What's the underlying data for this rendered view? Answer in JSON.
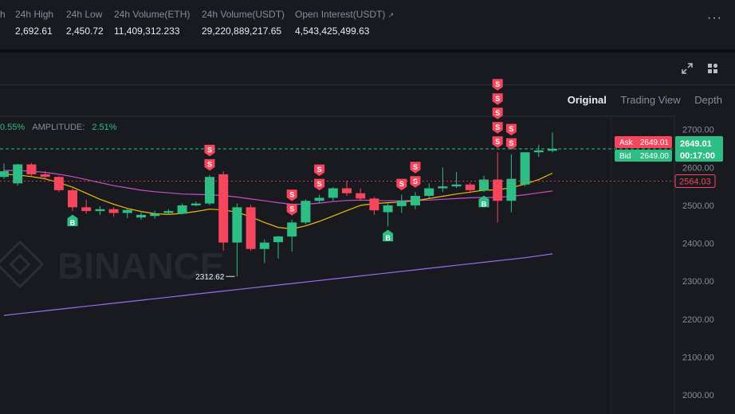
{
  "stats": {
    "cut_label": "h",
    "items": [
      {
        "label": "24h High",
        "value": "2,692.61"
      },
      {
        "label": "24h Low",
        "value": "2,450.72"
      },
      {
        "label": "24h Volume(ETH)",
        "value": "11,409,312.233"
      },
      {
        "label": "24h Volume(USDT)",
        "value": "29,220,889,217.65"
      },
      {
        "label": "Open Interest(USDT)",
        "value": "4,543,425,499.63"
      }
    ],
    "more_label": "···"
  },
  "tabs": {
    "original": "Original",
    "trading_view": "Trading View",
    "depth": "Depth"
  },
  "legend": {
    "change": "0.55%",
    "amplitude_label": "AMPLITUDE:",
    "amplitude_value": "2.51%"
  },
  "price_scale": {
    "labels": [
      "2700.00",
      "2600.00",
      "2500.00",
      "2400.00",
      "2300.00",
      "2200.00",
      "2100.00",
      "2000.00"
    ],
    "ask_label": "Ask",
    "ask_value": "2649.01",
    "bid_label": "Bid",
    "bid_value": "2649.00",
    "last_price": "2649.01",
    "countdown": "00:17:00",
    "mark_price": "2564.03"
  },
  "markers": {
    "sell": "S",
    "buy": "B"
  },
  "annotations": {
    "low_price": "2312.62"
  },
  "watermark": "BINANCE",
  "colors": {
    "up": "#2ebd85",
    "down": "#f6465d",
    "ma_fast": "#f0b90b",
    "ma_mid": "#c94fc7",
    "ma_slow": "#9a6cf5",
    "background": "#181a20"
  },
  "chart_data": {
    "type": "candlestick",
    "ylim": [
      1950,
      2735
    ],
    "candles": [
      {
        "o": 2575,
        "h": 2610,
        "l": 2570,
        "c": 2590
      },
      {
        "o": 2558,
        "h": 2610,
        "l": 2552,
        "c": 2608
      },
      {
        "o": 2608,
        "h": 2612,
        "l": 2578,
        "c": 2582
      },
      {
        "o": 2582,
        "h": 2590,
        "l": 2570,
        "c": 2575
      },
      {
        "o": 2575,
        "h": 2578,
        "l": 2535,
        "c": 2540
      },
      {
        "o": 2540,
        "h": 2545,
        "l": 2485,
        "c": 2495
      },
      {
        "o": 2495,
        "h": 2515,
        "l": 2478,
        "c": 2485
      },
      {
        "o": 2485,
        "h": 2498,
        "l": 2475,
        "c": 2490
      },
      {
        "o": 2490,
        "h": 2495,
        "l": 2470,
        "c": 2480
      },
      {
        "o": 2480,
        "h": 2492,
        "l": 2466,
        "c": 2488
      },
      {
        "o": 2468,
        "h": 2485,
        "l": 2462,
        "c": 2475
      },
      {
        "o": 2472,
        "h": 2486,
        "l": 2465,
        "c": 2478
      },
      {
        "o": 2480,
        "h": 2490,
        "l": 2475,
        "c": 2485
      },
      {
        "o": 2478,
        "h": 2505,
        "l": 2476,
        "c": 2500
      },
      {
        "o": 2500,
        "h": 2510,
        "l": 2498,
        "c": 2505
      },
      {
        "o": 2505,
        "h": 2580,
        "l": 2500,
        "c": 2575
      },
      {
        "o": 2582,
        "h": 2590,
        "l": 2380,
        "c": 2402
      },
      {
        "o": 2402,
        "h": 2505,
        "l": 2312.62,
        "c": 2495
      },
      {
        "o": 2495,
        "h": 2502,
        "l": 2380,
        "c": 2385
      },
      {
        "o": 2385,
        "h": 2410,
        "l": 2348,
        "c": 2402
      },
      {
        "o": 2403,
        "h": 2420,
        "l": 2360,
        "c": 2418
      },
      {
        "o": 2418,
        "h": 2462,
        "l": 2378,
        "c": 2455
      },
      {
        "o": 2455,
        "h": 2516,
        "l": 2450,
        "c": 2512
      },
      {
        "o": 2512,
        "h": 2528,
        "l": 2505,
        "c": 2520
      },
      {
        "o": 2520,
        "h": 2548,
        "l": 2512,
        "c": 2545
      },
      {
        "o": 2545,
        "h": 2565,
        "l": 2525,
        "c": 2532
      },
      {
        "o": 2532,
        "h": 2545,
        "l": 2512,
        "c": 2518
      },
      {
        "o": 2518,
        "h": 2522,
        "l": 2475,
        "c": 2487
      },
      {
        "o": 2482,
        "h": 2505,
        "l": 2445,
        "c": 2500
      },
      {
        "o": 2498,
        "h": 2528,
        "l": 2480,
        "c": 2512
      },
      {
        "o": 2500,
        "h": 2535,
        "l": 2490,
        "c": 2525
      },
      {
        "o": 2525,
        "h": 2558,
        "l": 2518,
        "c": 2545
      },
      {
        "o": 2545,
        "h": 2600,
        "l": 2535,
        "c": 2550
      },
      {
        "o": 2550,
        "h": 2588,
        "l": 2546,
        "c": 2555
      },
      {
        "o": 2555,
        "h": 2560,
        "l": 2532,
        "c": 2540
      },
      {
        "o": 2540,
        "h": 2578,
        "l": 2535,
        "c": 2568
      },
      {
        "o": 2568,
        "h": 2640,
        "l": 2455,
        "c": 2512
      },
      {
        "o": 2512,
        "h": 2635,
        "l": 2482,
        "c": 2570
      },
      {
        "o": 2555,
        "h": 2640,
        "l": 2550,
        "c": 2640
      },
      {
        "o": 2640,
        "h": 2660,
        "l": 2628,
        "c": 2645
      },
      {
        "o": 2644,
        "h": 2692.61,
        "l": 2640,
        "c": 2649.01
      }
    ],
    "ma_fast": [
      2582,
      2580,
      2576,
      2570,
      2560,
      2548,
      2532,
      2516,
      2503,
      2492,
      2484,
      2478,
      2476,
      2479,
      2484,
      2490,
      2488,
      2482,
      2470,
      2455,
      2442,
      2438,
      2446,
      2458,
      2472,
      2486,
      2500,
      2505,
      2507,
      2509,
      2512,
      2518,
      2524,
      2530,
      2535,
      2540,
      2541,
      2547,
      2556,
      2568,
      2585
    ],
    "ma_mid": [
      2592,
      2592,
      2590,
      2587,
      2582,
      2576,
      2568,
      2560,
      2552,
      2546,
      2540,
      2536,
      2533,
      2530,
      2529,
      2528,
      2526,
      2522,
      2517,
      2512,
      2507,
      2503,
      2503,
      2506,
      2510,
      2513,
      2514,
      2513,
      2512,
      2512,
      2513,
      2514,
      2516,
      2518,
      2520,
      2521,
      2521,
      2524,
      2528,
      2533,
      2538
    ],
    "ma_slow": [
      2210,
      2214,
      2218,
      2222,
      2226,
      2230,
      2234,
      2238,
      2242,
      2246,
      2250,
      2254,
      2258,
      2262,
      2266,
      2270,
      2274,
      2278,
      2282,
      2286,
      2290,
      2294,
      2298,
      2302,
      2306,
      2310,
      2314,
      2318,
      2322,
      2326,
      2330,
      2334,
      2338,
      2342,
      2346,
      2350,
      2354,
      2358,
      2362,
      2367,
      2372
    ],
    "sell_markers": [
      {
        "index": 15,
        "count": 2
      },
      {
        "index": 21,
        "count": 2
      },
      {
        "index": 23,
        "count": 2
      },
      {
        "index": 29,
        "count": 1
      },
      {
        "index": 30,
        "count": 2
      },
      {
        "index": 36,
        "count": 5
      },
      {
        "index": 37,
        "count": 2
      }
    ],
    "buy_markers": [
      {
        "index": 5
      },
      {
        "index": 28
      },
      {
        "index": 35
      }
    ]
  }
}
